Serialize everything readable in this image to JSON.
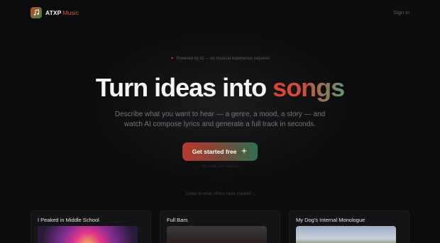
{
  "header": {
    "brand_primary": "ATXP",
    "brand_secondary": "Music",
    "logo_icon": "music-note-icon",
    "signin_label": "Sign in"
  },
  "hero": {
    "pill_text": "Powered by AI — no musical experience required",
    "headline_main": "Turn ideas into",
    "headline_accent": "songs",
    "subtitle": "Describe what you want to hear — a genre, a mood, a story — and watch AI compose lyrics and generate a full track in seconds.",
    "cta_label": "Get started free",
    "cta_icon": "sparkle-icon",
    "cta_note": "No credit card required",
    "listen_link": "Listen to what others have created ↓"
  },
  "cards": [
    {
      "title": "I Peaked in Middle School"
    },
    {
      "title": "Full Bars"
    },
    {
      "title": "My Dog's Internal Monologue"
    }
  ],
  "colors": {
    "background": "#0c0c0d",
    "accent_red": "#e0422e",
    "accent_green": "#5f9a73"
  }
}
